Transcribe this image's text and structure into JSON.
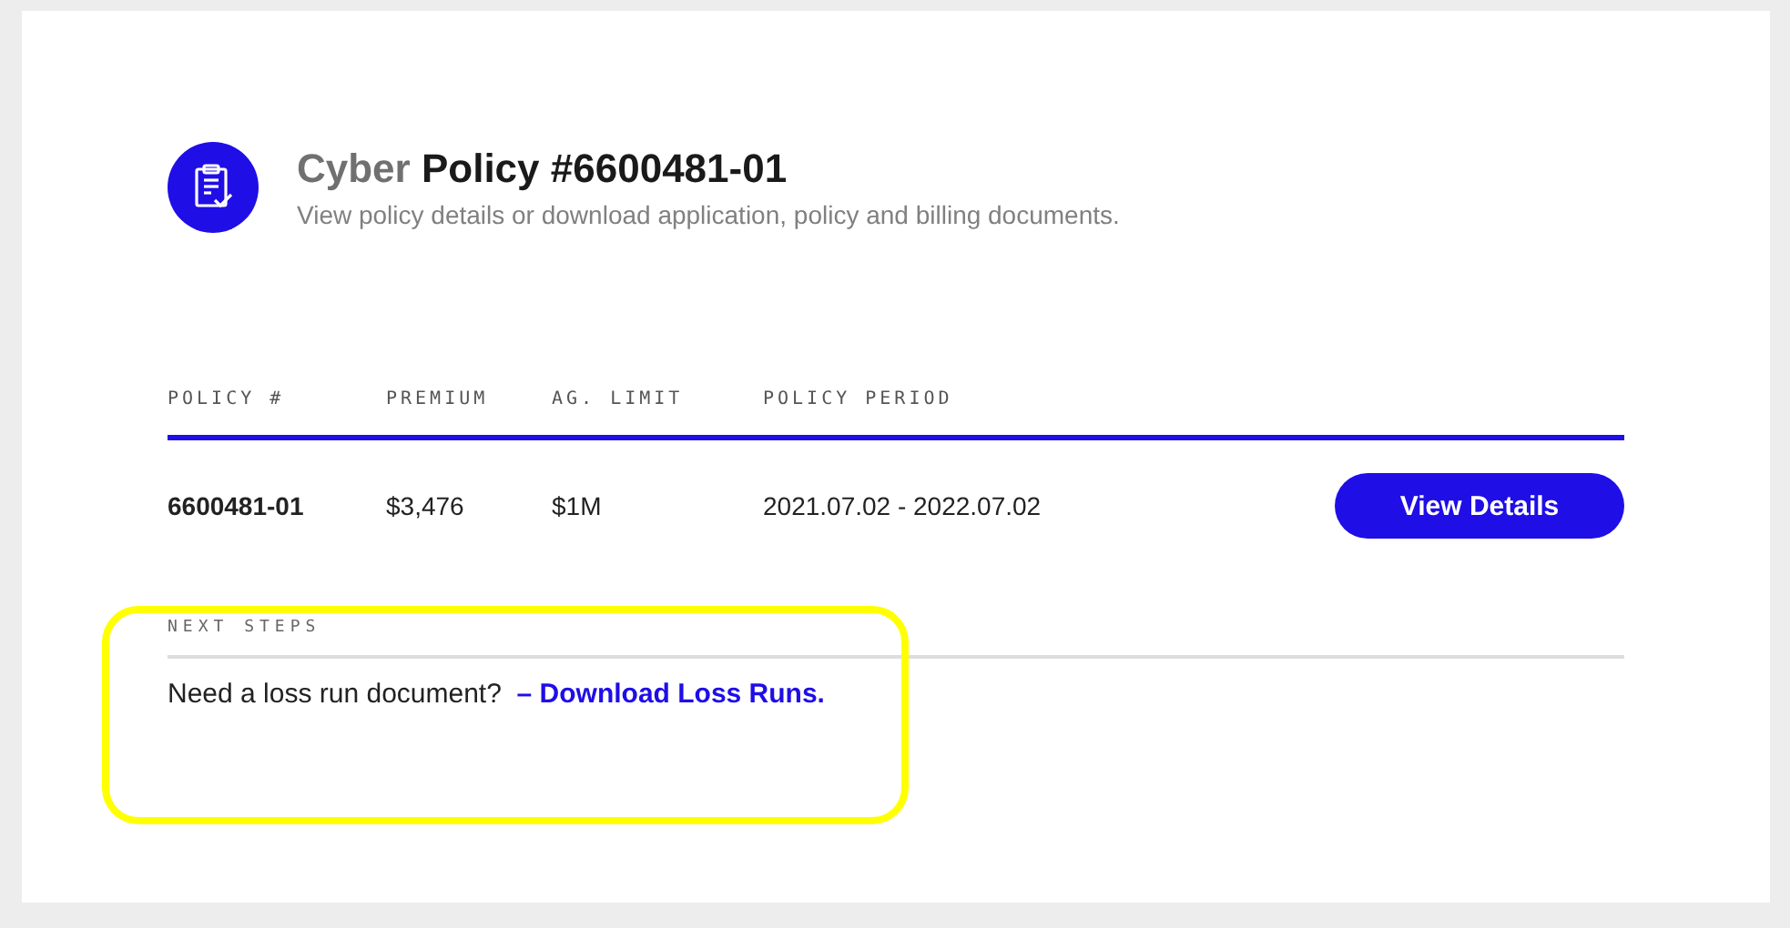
{
  "header": {
    "title_prefix": "Cyber",
    "title": "Policy #6600481-01",
    "subtitle": "View policy details or download application, policy and billing documents."
  },
  "table": {
    "columns": [
      "POLICY #",
      "PREMIUM",
      "AG. LIMIT",
      "POLICY PERIOD"
    ],
    "rows": [
      {
        "cells": [
          "6600481-01",
          "$3,476",
          "$1M",
          "2021.07.02 - 2022.07.02"
        ],
        "action": "View Details"
      }
    ]
  },
  "next_steps": {
    "heading": "NEXT STEPS",
    "text": "Need a loss run document?",
    "link": "– Download Loss Runs."
  }
}
